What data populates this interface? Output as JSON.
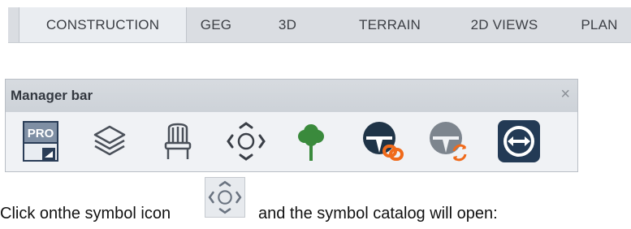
{
  "ribbon": {
    "tabs": [
      {
        "label": "CONSTRUCTION",
        "active": true
      },
      {
        "label": "GEG",
        "active": false
      },
      {
        "label": "3D",
        "active": false
      },
      {
        "label": "TERRAIN",
        "active": false
      },
      {
        "label": "2D VIEWS",
        "active": false
      },
      {
        "label": "PLAN",
        "active": false
      }
    ]
  },
  "manager_bar": {
    "title": "Manager bar",
    "close_glyph": "×",
    "icons": [
      {
        "name": "pro-icon",
        "label": "PRO"
      },
      {
        "name": "layers-icon"
      },
      {
        "name": "chair-icon"
      },
      {
        "name": "symbol-catalog-icon"
      },
      {
        "name": "tree-icon"
      },
      {
        "name": "teamviewer-link-icon"
      },
      {
        "name": "teamviewer-sync-icon"
      },
      {
        "name": "remote-arrow-icon"
      }
    ]
  },
  "instruction": {
    "before": "Click onthe symbol icon",
    "after": "and the symbol catalog will open:"
  },
  "colors": {
    "ribbon_bg": "#dadde2",
    "tree_green": "#3a8a3c",
    "orange": "#f06a1a",
    "navy": "#233a55"
  }
}
